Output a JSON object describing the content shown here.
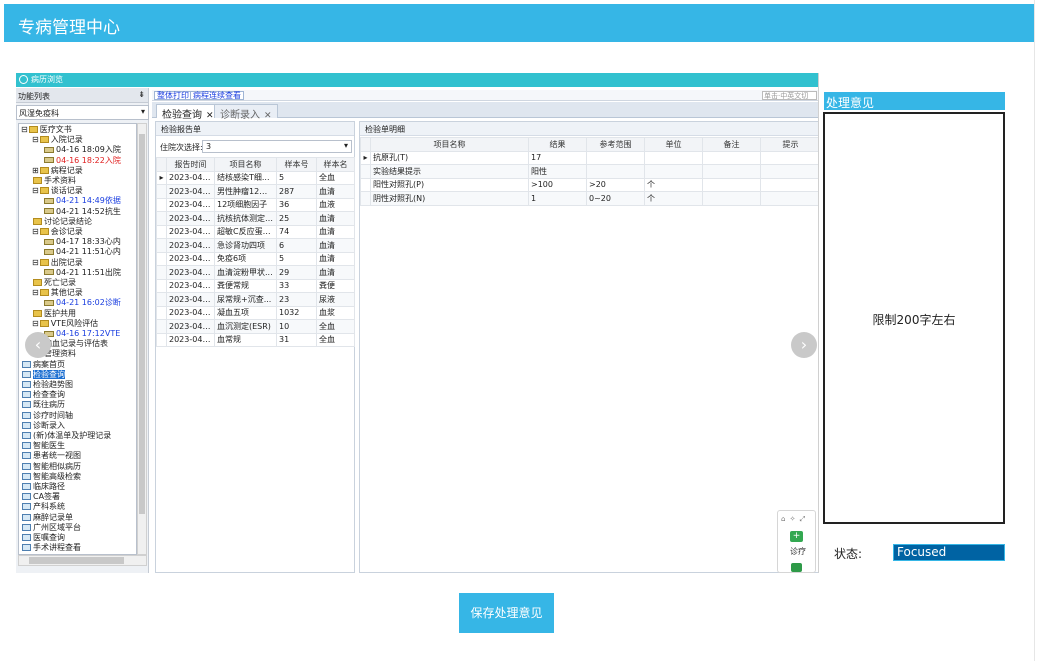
{
  "header": {
    "title": "专病管理中心"
  },
  "window": {
    "title": "病历浏览"
  },
  "left_panel": {
    "title": "功能列表",
    "pin": "⇟",
    "category": "风湿免疫科",
    "tree": [
      {
        "indent": 0,
        "prefix": "⊟",
        "icon": "folder",
        "label": "医疗文书",
        "style": ""
      },
      {
        "indent": 1,
        "prefix": "⊟",
        "icon": "folder",
        "label": "入院记录",
        "style": ""
      },
      {
        "indent": 2,
        "prefix": "",
        "icon": "doc",
        "label": "04-16 18:09入院",
        "style": ""
      },
      {
        "indent": 2,
        "prefix": "",
        "icon": "doc",
        "label": "04-16 18:22入院",
        "style": "red"
      },
      {
        "indent": 1,
        "prefix": "⊞",
        "icon": "folder",
        "label": "病程记录",
        "style": ""
      },
      {
        "indent": 1,
        "prefix": "",
        "icon": "folder",
        "label": "手术资料",
        "style": ""
      },
      {
        "indent": 1,
        "prefix": "⊟",
        "icon": "folder",
        "label": "谈话记录",
        "style": ""
      },
      {
        "indent": 2,
        "prefix": "",
        "icon": "doc",
        "label": "04-21 14:49依据",
        "style": "blue"
      },
      {
        "indent": 2,
        "prefix": "",
        "icon": "doc",
        "label": "04-21 14:52抗生",
        "style": ""
      },
      {
        "indent": 1,
        "prefix": "",
        "icon": "folder",
        "label": "讨论记录结论",
        "style": ""
      },
      {
        "indent": 1,
        "prefix": "⊟",
        "icon": "folder",
        "label": "会诊记录",
        "style": ""
      },
      {
        "indent": 2,
        "prefix": "",
        "icon": "doc",
        "label": "04-17 18:33心内",
        "style": ""
      },
      {
        "indent": 2,
        "prefix": "",
        "icon": "doc",
        "label": "04-21 11:51心内",
        "style": ""
      },
      {
        "indent": 1,
        "prefix": "⊟",
        "icon": "folder",
        "label": "出院记录",
        "style": ""
      },
      {
        "indent": 2,
        "prefix": "",
        "icon": "doc",
        "label": "04-21 11:51出院",
        "style": ""
      },
      {
        "indent": 1,
        "prefix": "",
        "icon": "folder",
        "label": "死亡记录",
        "style": ""
      },
      {
        "indent": 1,
        "prefix": "⊟",
        "icon": "folder",
        "label": "其他记录",
        "style": ""
      },
      {
        "indent": 2,
        "prefix": "",
        "icon": "doc",
        "label": "04-21 16:02诊断",
        "style": "blue"
      },
      {
        "indent": 1,
        "prefix": "",
        "icon": "folder",
        "label": "医护共用",
        "style": ""
      },
      {
        "indent": 1,
        "prefix": "⊟",
        "icon": "folder",
        "label": "VTE风险评估",
        "style": ""
      },
      {
        "indent": 2,
        "prefix": "",
        "icon": "doc",
        "label": "04-16 17:12VTE",
        "style": "blue"
      },
      {
        "indent": 1,
        "prefix": "",
        "icon": "folder",
        "label": "输血记录与评估表",
        "style": ""
      },
      {
        "indent": 1,
        "prefix": "",
        "icon": "folder",
        "label": "管理资料",
        "style": ""
      },
      {
        "indent": 0,
        "prefix": "",
        "icon": "page",
        "label": "病案首页",
        "style": ""
      },
      {
        "indent": 0,
        "prefix": "",
        "icon": "page",
        "label": "检验查询",
        "style": "selected"
      },
      {
        "indent": 0,
        "prefix": "",
        "icon": "page",
        "label": "检验趋势图",
        "style": ""
      },
      {
        "indent": 0,
        "prefix": "",
        "icon": "page",
        "label": "检查查询",
        "style": ""
      },
      {
        "indent": 0,
        "prefix": "",
        "icon": "page",
        "label": "既往病历",
        "style": ""
      },
      {
        "indent": 0,
        "prefix": "",
        "icon": "page",
        "label": "诊疗时间轴",
        "style": ""
      },
      {
        "indent": 0,
        "prefix": "",
        "icon": "page",
        "label": "诊断录入",
        "style": ""
      },
      {
        "indent": 0,
        "prefix": "",
        "icon": "page",
        "label": "(新)体温单及护理记录",
        "style": ""
      },
      {
        "indent": 0,
        "prefix": "",
        "icon": "page",
        "label": "智能医生",
        "style": ""
      },
      {
        "indent": 0,
        "prefix": "",
        "icon": "page",
        "label": "患者统一视图",
        "style": ""
      },
      {
        "indent": 0,
        "prefix": "",
        "icon": "page",
        "label": "智能相似病历",
        "style": ""
      },
      {
        "indent": 0,
        "prefix": "",
        "icon": "page",
        "label": "智能高级检索",
        "style": ""
      },
      {
        "indent": 0,
        "prefix": "",
        "icon": "page",
        "label": "临床路径",
        "style": ""
      },
      {
        "indent": 0,
        "prefix": "",
        "icon": "page",
        "label": "CA签署",
        "style": ""
      },
      {
        "indent": 0,
        "prefix": "",
        "icon": "page",
        "label": "产科系统",
        "style": ""
      },
      {
        "indent": 0,
        "prefix": "",
        "icon": "page",
        "label": "麻醉记录单",
        "style": ""
      },
      {
        "indent": 0,
        "prefix": "",
        "icon": "page",
        "label": "广州区域平台",
        "style": ""
      },
      {
        "indent": 0,
        "prefix": "",
        "icon": "page",
        "label": "医嘱查询",
        "style": ""
      },
      {
        "indent": 0,
        "prefix": "",
        "icon": "page",
        "label": "手术讲程查看",
        "style": ""
      }
    ]
  },
  "toolbar": {
    "print_all": "整体打印",
    "continuous_view": "病程连续查看",
    "search_placeholder": "单击·中英文切"
  },
  "tabs": [
    {
      "label": "检验查询",
      "close": "✕"
    },
    {
      "label": "诊断录入",
      "close": "✕"
    }
  ],
  "lab_reports": {
    "title": "检验报告单",
    "visit_label": "住院次选择:",
    "visit_value": "3",
    "columns": [
      "报告时间",
      "项目名称",
      "样本号",
      "样本名"
    ],
    "rows": [
      [
        "2023-04-1...",
        "结核感染T细...",
        "5",
        "全血"
      ],
      [
        "2023-04-1...",
        "男性肿瘤12项...",
        "287",
        "血清"
      ],
      [
        "2023-04-1...",
        "12项细胞因子",
        "36",
        "血液"
      ],
      [
        "2023-04-1...",
        "抗核抗体测定(...",
        "25",
        "血清"
      ],
      [
        "2023-04-1...",
        "超敏C反应蛋白...",
        "74",
        "血清"
      ],
      [
        "2023-04-1...",
        "急诊肾功四项",
        "6",
        "血清"
      ],
      [
        "2023-04-1...",
        "免疫6项",
        "5",
        "血清"
      ],
      [
        "2023-04-1...",
        "血清淀粉甲状...",
        "29",
        "血清"
      ],
      [
        "2023-04-1...",
        "粪便常规",
        "33",
        "粪便"
      ],
      [
        "2023-04-1...",
        "尿常规+沉查...",
        "23",
        "尿液"
      ],
      [
        "2023-04-1...",
        "凝血五项",
        "1032",
        "血浆"
      ],
      [
        "2023-04-1...",
        "血沉测定(ESR)",
        "10",
        "全血"
      ],
      [
        "2023-04-1...",
        "血常规",
        "31",
        "全血"
      ]
    ]
  },
  "lab_detail": {
    "title": "检验单明细",
    "columns": [
      "项目名称",
      "结果",
      "参考范围",
      "单位",
      "备注",
      "提示"
    ],
    "rows": [
      [
        "抗原孔(T)",
        "17",
        "",
        "",
        "",
        ""
      ],
      [
        "实验结果提示",
        "阳性",
        "",
        "",
        "",
        ""
      ],
      [
        "阳性对照孔(P)",
        ">100",
        ">20",
        "个",
        "",
        ""
      ],
      [
        "阴性对照孔(N)",
        "1",
        "0~20",
        "个",
        "",
        ""
      ]
    ]
  },
  "float_tool": {
    "icons": "⌂ ✧ ⤢",
    "label": "诊疗",
    "plus": "+"
  },
  "nav": {
    "prev": "‹",
    "next": "›"
  },
  "opinion": {
    "header": "处理意见",
    "placeholder": "限制200字左右"
  },
  "status": {
    "label": "状态:",
    "value": "Focused"
  },
  "save_button": "保存处理意见",
  "colors": {
    "accent": "#36b6e6",
    "status_bg": "#0063a3",
    "window_bar": "#32c1cf"
  }
}
